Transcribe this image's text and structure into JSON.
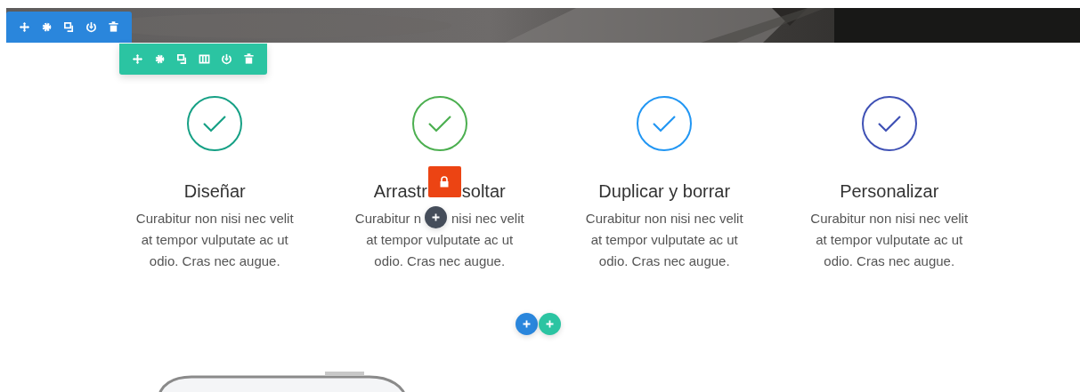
{
  "row_toolbar": {
    "tools": [
      {
        "kind": "move"
      },
      {
        "kind": "settings"
      },
      {
        "kind": "duplicate"
      },
      {
        "kind": "power"
      },
      {
        "kind": "delete"
      }
    ]
  },
  "column_toolbar": {
    "tools": [
      {
        "kind": "move"
      },
      {
        "kind": "settings"
      },
      {
        "kind": "duplicate"
      },
      {
        "kind": "columns"
      },
      {
        "kind": "power"
      },
      {
        "kind": "delete"
      }
    ]
  },
  "features": [
    {
      "kind": "plain",
      "title": "Diseñar",
      "text": "Curabitur non nisi nec velit at tempor vulputate ac ut odio. Cras nec augue.",
      "color": "#16a085"
    },
    {
      "kind": "covered",
      "title_pieces": [
        "Arrastr",
        "soltar"
      ],
      "text_pieces": [
        "Curabitur n",
        "nisi nec velit",
        "at tempor vulputate ac ut odio. Cras nec augue."
      ],
      "color": "#4caf50"
    },
    {
      "kind": "plain",
      "title": "Duplicar y borrar",
      "text": "Curabitur non nisi nec velit at tempor vulputate ac ut odio. Cras nec augue.",
      "color": "#2196f3"
    },
    {
      "kind": "plain",
      "title": "Personalizar",
      "text": "Curabitur non nisi nec velit at tempor vulputate ac ut odio. Cras nec augue.",
      "color": "#3f51b5"
    }
  ],
  "add_buttons": [
    {
      "kind": "row"
    },
    {
      "kind": "column"
    }
  ]
}
